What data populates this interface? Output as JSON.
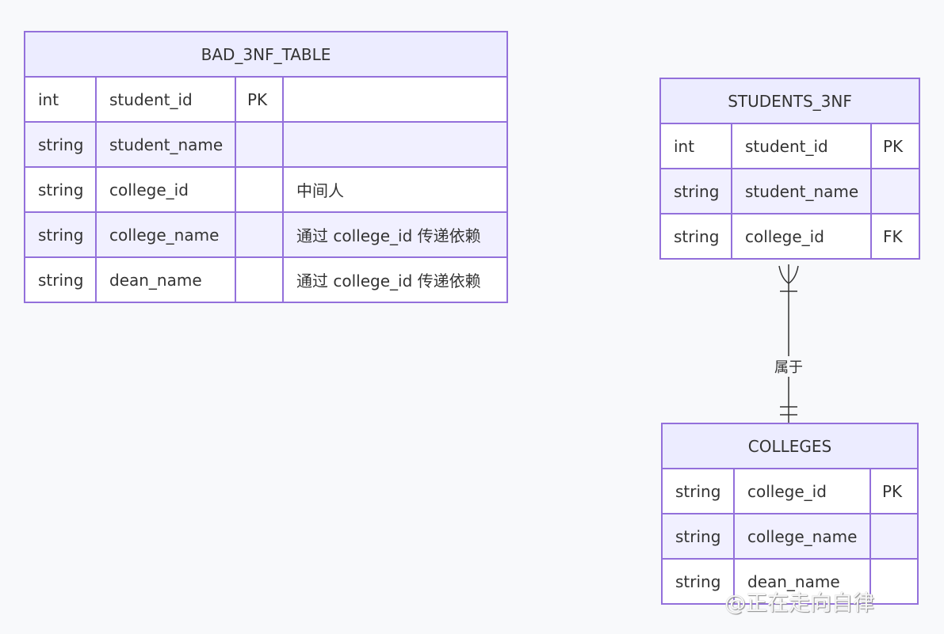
{
  "relationship_label": "属于",
  "watermark": "@正在走向自律",
  "colors": {
    "border": "#9370DB",
    "header_bg": "#ECECFF",
    "alt_row_bg": "#F1F0FF",
    "line": "#333333",
    "background": "#f8f9fb"
  },
  "tables": {
    "bad": {
      "title": "BAD_3NF_TABLE",
      "rows": [
        {
          "type": "int",
          "name": "student_id",
          "key": "PK",
          "comment": ""
        },
        {
          "type": "string",
          "name": "student_name",
          "key": "",
          "comment": ""
        },
        {
          "type": "string",
          "name": "college_id",
          "key": "",
          "comment": "中间人"
        },
        {
          "type": "string",
          "name": "college_name",
          "key": "",
          "comment": "通过 college_id 传递依赖"
        },
        {
          "type": "string",
          "name": "dean_name",
          "key": "",
          "comment": "通过 college_id 传递依赖"
        }
      ]
    },
    "students": {
      "title": "STUDENTS_3NF",
      "rows": [
        {
          "type": "int",
          "name": "student_id",
          "key": "PK"
        },
        {
          "type": "string",
          "name": "student_name",
          "key": ""
        },
        {
          "type": "string",
          "name": "college_id",
          "key": "FK"
        }
      ]
    },
    "colleges": {
      "title": "COLLEGES",
      "rows": [
        {
          "type": "string",
          "name": "college_id",
          "key": "PK"
        },
        {
          "type": "string",
          "name": "college_name",
          "key": ""
        },
        {
          "type": "string",
          "name": "dean_name",
          "key": ""
        }
      ]
    }
  }
}
